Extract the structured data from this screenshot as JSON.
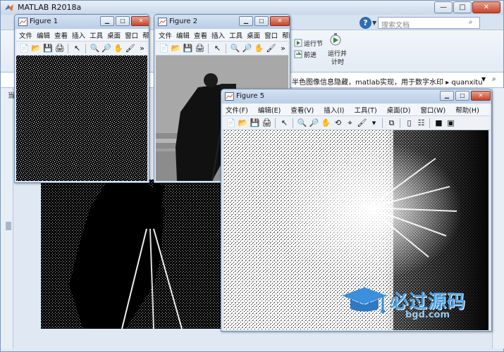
{
  "main_window": {
    "title": "MATLAB R2018a",
    "controls": {
      "minimize": "—",
      "maximize": "□",
      "close": "✕"
    }
  },
  "search": {
    "placeholder": "搜索文档"
  },
  "ribbon": {
    "run_section": "运行节",
    "advance": "前进",
    "run_and_time": "运行并\n计时",
    "run_and_time_line1": "运行并",
    "run_and_time_line2": "计时"
  },
  "path_bar": {
    "path": "半色图像信息隐藏，matlab实现，用于数字水印 ▸ quanxitu"
  },
  "left_panel": {
    "label": "当"
  },
  "figures": [
    {
      "id": "figure-1",
      "title": "Figure 1",
      "menu": [
        "文件",
        "编辑",
        "查看",
        "插入",
        "工具",
        "桌面",
        "窗口",
        "帮助"
      ],
      "more": "»"
    },
    {
      "id": "figure-2",
      "title": "Figure 2",
      "menu": [
        "文件",
        "编辑",
        "查看",
        "插入",
        "工具",
        "桌面",
        "窗口",
        "帮助"
      ],
      "more": "»"
    },
    {
      "id": "figure-5",
      "title": "Figure 5",
      "menu": [
        "文件(F)",
        "编辑(E)",
        "查看(V)",
        "插入(I)",
        "工具(T)",
        "桌面(D)",
        "窗口(W)",
        "帮助(H)"
      ]
    }
  ],
  "watermark": {
    "brand": "必过源码",
    "site": "bgd.com"
  },
  "colors": {
    "title_gradient_top": "#e6eef8",
    "figure_title": "#c9d8ea",
    "close_button": "#c7452c",
    "watermark_blue": "#4aa3e8"
  }
}
